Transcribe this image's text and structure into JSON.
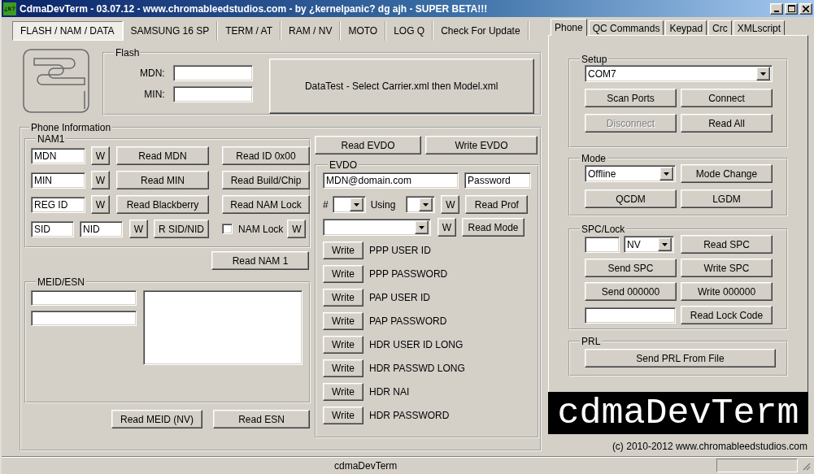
{
  "window": {
    "icon_text": "¿k?",
    "title": "CdmaDevTerm - 03.07.12 - www.chromableedstudios.com - by ¿kernelpanic? dg ajh - SUPER BETA!!!"
  },
  "main_tabs": [
    {
      "label": "FLASH / NAM / DATA",
      "selected": true
    },
    {
      "label": "SAMSUNG 16 SP",
      "selected": false
    },
    {
      "label": "TERM / AT",
      "selected": false
    },
    {
      "label": "RAM / NV",
      "selected": false
    },
    {
      "label": "MOTO",
      "selected": false
    },
    {
      "label": "LOG Q",
      "selected": false
    },
    {
      "label": "Check For Update",
      "selected": false
    }
  ],
  "flash": {
    "title": "Flash",
    "fields": [
      {
        "label": "MDN:"
      },
      {
        "label": "MIN:"
      }
    ],
    "button": "DataTest - Select Carrier.xml then Model.xml"
  },
  "phone_information": {
    "title": "Phone Information",
    "nam1": {
      "title": "NAM1",
      "rows": [
        {
          "kind": "read",
          "fields": [
            "MDN"
          ],
          "write": "W",
          "read": "Read MDN",
          "extra": "Read ID 0x00"
        },
        {
          "kind": "read",
          "fields": [
            "MIN"
          ],
          "write": "W",
          "read": "Read MIN",
          "extra": "Read Build/Chip"
        },
        {
          "kind": "read",
          "fields": [
            "REG ID"
          ],
          "write": "W",
          "read": "Read Blackberry",
          "extra": "Read NAM Lock"
        },
        {
          "kind": "lock",
          "fields": [
            "SID",
            "NID"
          ],
          "write": "W",
          "read": "R SID/NID",
          "lock": {
            "label": "NAM Lock",
            "checked": false,
            "write": "W"
          }
        }
      ]
    },
    "read_nam": "Read NAM 1",
    "meid_esn": {
      "title": "MEID/ESN",
      "buttons": [
        "Read MEID (NV)",
        "Read ESN"
      ]
    },
    "evdo_buttons": [
      "Read EVDO",
      "Write EVDO"
    ],
    "evdo": {
      "title": "EVDO",
      "user": "MDN@domain.com",
      "password": "Password",
      "profile_label": "#",
      "using_label": "Using",
      "write_buttons": [
        "W",
        "W"
      ],
      "read_prof": "Read Prof",
      "read_mode": "Read Mode",
      "writes": [
        {
          "button": "Write",
          "label": "PPP USER ID"
        },
        {
          "button": "Write",
          "label": "PPP PASSWORD"
        },
        {
          "button": "Write",
          "label": "PAP USER ID"
        },
        {
          "button": "Write",
          "label": "PAP PASSWORD"
        },
        {
          "button": "Write",
          "label": "HDR USER ID LONG"
        },
        {
          "button": "Write",
          "label": "HDR PASSWD LONG"
        },
        {
          "button": "Write",
          "label": "HDR NAI"
        },
        {
          "button": "Write",
          "label": "HDR PASSWORD"
        }
      ]
    }
  },
  "side_tabs": [
    {
      "label": "Phone",
      "selected": true
    },
    {
      "label": "QC Commands",
      "selected": false
    },
    {
      "label": "Keypad",
      "selected": false
    },
    {
      "label": "Crc",
      "selected": false
    },
    {
      "label": "XMLscript",
      "selected": false
    }
  ],
  "setup": {
    "title": "Setup",
    "port": "COM7",
    "buttons": [
      {
        "label": "Scan Ports",
        "disabled": false
      },
      {
        "label": "Connect",
        "disabled": false
      },
      {
        "label": "Disconnect",
        "disabled": true
      },
      {
        "label": "Read All",
        "disabled": false
      }
    ]
  },
  "mode": {
    "title": "Mode",
    "value": "Offline",
    "buttons": [
      "Mode Change",
      "QCDM",
      "LGDM"
    ]
  },
  "spc_lock": {
    "title": "SPC/Lock",
    "spc_type": "NV",
    "buttons": [
      "Read SPC",
      "Send SPC",
      "Write SPC",
      "Send 000000",
      "Write 000000",
      "Read Lock Code"
    ]
  },
  "prl": {
    "title": "PRL",
    "button": "Send PRL From File"
  },
  "banner": "cdmaDevTerm",
  "copyright": "(c) 2010-2012 www.chromableedstudios.com",
  "status_bar": {
    "text": "cdmaDevTerm"
  }
}
